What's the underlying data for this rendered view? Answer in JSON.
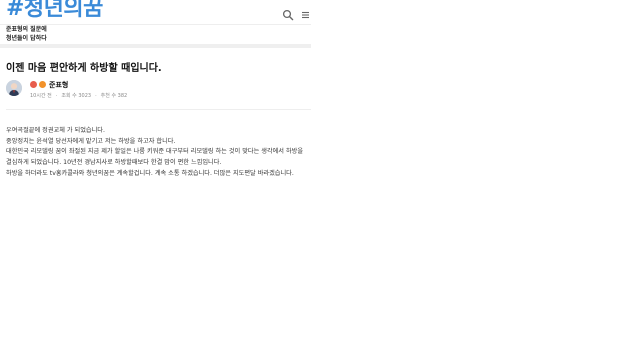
{
  "site": {
    "brand": "#청년의꿈"
  },
  "header": {
    "search_icon": "search-icon",
    "menu_icon": "menu-icon"
  },
  "subnav": {
    "items": [
      "준표형의 질문에",
      "청년들이 답하다"
    ]
  },
  "post": {
    "title": "이젠 마음 편안하게 하방할 때입니다.",
    "author": "준표형",
    "meta": {
      "time": "10시간 전",
      "views": "조회 수 3023",
      "recommends": "추천 수 382"
    },
    "body": [
      "우여곡절끝에 정권교체 가 되었습니다.",
      "중앙정치는 윤석열 당선자에게 맡기고 저는 하방을 하고자 합니다.",
      "대한민국 리모델링 꿈이 좌절된 지금 제가 할일은 나룸 키워준 대구부터 리모델링 하는 것이 맞다는 생각에서 하방을 결심하게 되었습니다. 10년전 경남지사로 하방할때보다 한결 맘이 편한 느낌입니다.",
      "하방을 하더라도 tv홍카콜라와 청년의꿈은 계속할겁니다. 계속 소통 하겠습니다. 더많은 지도편달 바라겠습니다."
    ]
  },
  "colors": {
    "brand": "#3a8ad8",
    "badge_red": "#e85d4d",
    "badge_orange": "#f2922a"
  }
}
